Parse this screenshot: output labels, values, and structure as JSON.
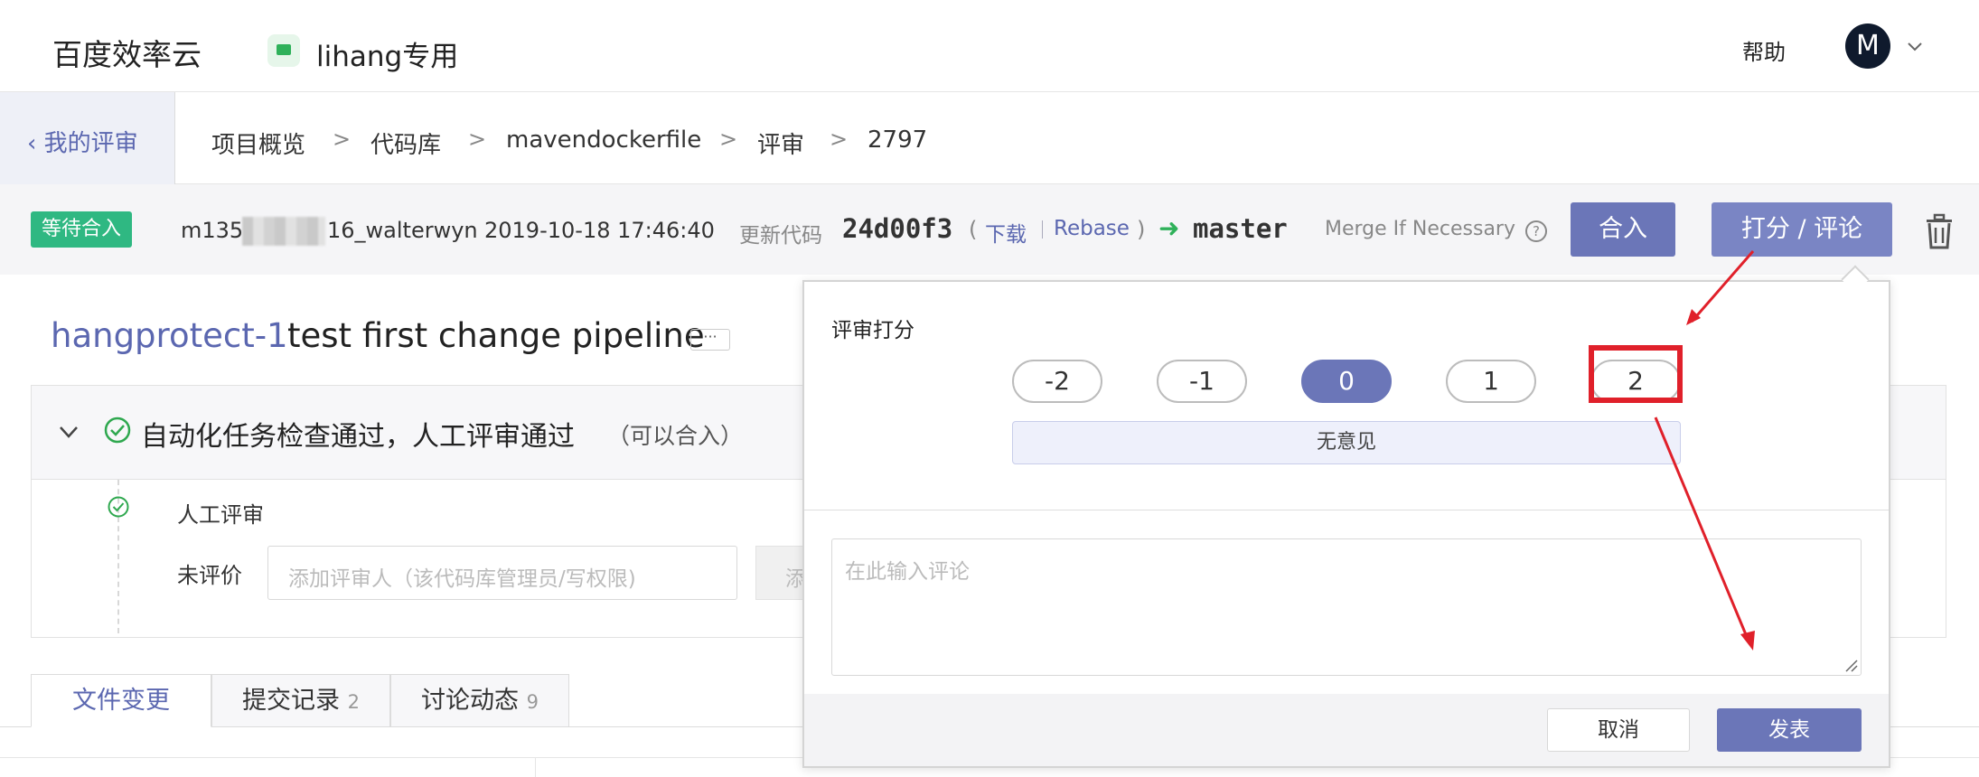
{
  "topnav": {
    "logo_text": "百度效率云",
    "project_icon": "project-monitor-icon",
    "project_name": "lihang专用",
    "help": "帮助",
    "avatar_letter": "M"
  },
  "breadcrumb": {
    "back": "我的评审",
    "items": [
      "项目概览",
      "代码库",
      "mavendockerfile",
      "评审",
      "2797"
    ],
    "separator": ">"
  },
  "status": {
    "badge": "等待合入",
    "author_prefix": "m135",
    "author_suffix": "16_walterwyn",
    "datetime": "2019-10-18 17:46:40",
    "update_label": "更新代码",
    "commit": "24d00f3",
    "open_paren": "(",
    "download": "下载",
    "rebase": "Rebase",
    "close_paren": ")",
    "arrow": "➜",
    "branch": "master",
    "merge_strategy": "Merge If Necessary",
    "help_mark": "?",
    "merge_button": "合入",
    "score_button": "打分 / 评论",
    "colors": {
      "badge": "#2fb882",
      "primary": "#6b76b8",
      "link": "#5b67b0"
    }
  },
  "title": {
    "prefix": "hangprotect-1",
    "text": "test first change pipeline",
    "more": "···"
  },
  "checks": {
    "summary": "自动化任务检查通过，人工评审通过",
    "summary_sub": "（可以合入）",
    "manual_review": "人工评审",
    "unrated_label": "未评价",
    "reviewer_placeholder": "添加评审人（该代码库管理员/写权限)",
    "add_button": "添"
  },
  "tabs": [
    {
      "label": "文件变更",
      "count": ""
    },
    {
      "label": "提交记录",
      "count": "2"
    },
    {
      "label": "讨论动态",
      "count": "9"
    }
  ],
  "popup": {
    "label": "评审打分",
    "scores": [
      "-2",
      "-1",
      "0",
      "1",
      "2"
    ],
    "selected_score": "0",
    "score_description": "无意见",
    "comment_placeholder": "在此输入评论",
    "cancel": "取消",
    "submit": "发表"
  }
}
